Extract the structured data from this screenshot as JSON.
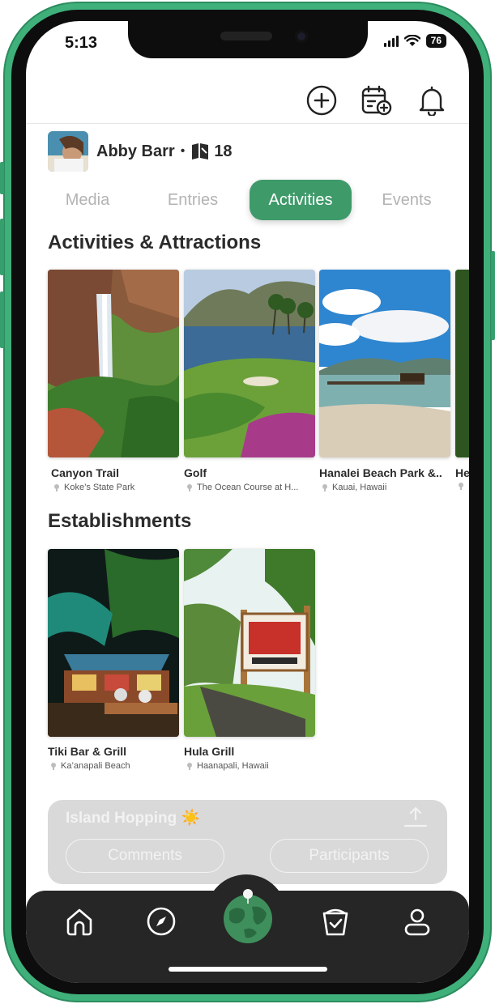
{
  "status_bar": {
    "time": "5:13",
    "battery": "76"
  },
  "profile": {
    "name": "Abby Barr",
    "separator": "•",
    "count": "18"
  },
  "tabs": [
    {
      "label": "Media"
    },
    {
      "label": "Entries"
    },
    {
      "label": "Activities"
    },
    {
      "label": "Events"
    }
  ],
  "activities": {
    "title": "Activities & Attractions",
    "cards": [
      {
        "title": "Canyon Trail",
        "location": "Koke’s State Park"
      },
      {
        "title": "Golf",
        "location": "The Ocean Course at H..."
      },
      {
        "title": "Hanalei Beach Park &..",
        "location": "Kauai, Hawaii"
      },
      {
        "title": "He",
        "location": ""
      }
    ]
  },
  "establishments": {
    "title": "Establishments",
    "cards": [
      {
        "title": "Tiki Bar & Grill",
        "location": "Ka’anapali Beach"
      },
      {
        "title": "Hula Grill",
        "location": "Haanapali, Hawaii"
      }
    ]
  },
  "trip": {
    "title": "Island Hopping ☀️",
    "comments_label": "Comments",
    "participants_label": "Participants"
  },
  "colors": {
    "accent": "#3f9a6a",
    "frame": "#3fb07a",
    "nav": "#262626"
  }
}
